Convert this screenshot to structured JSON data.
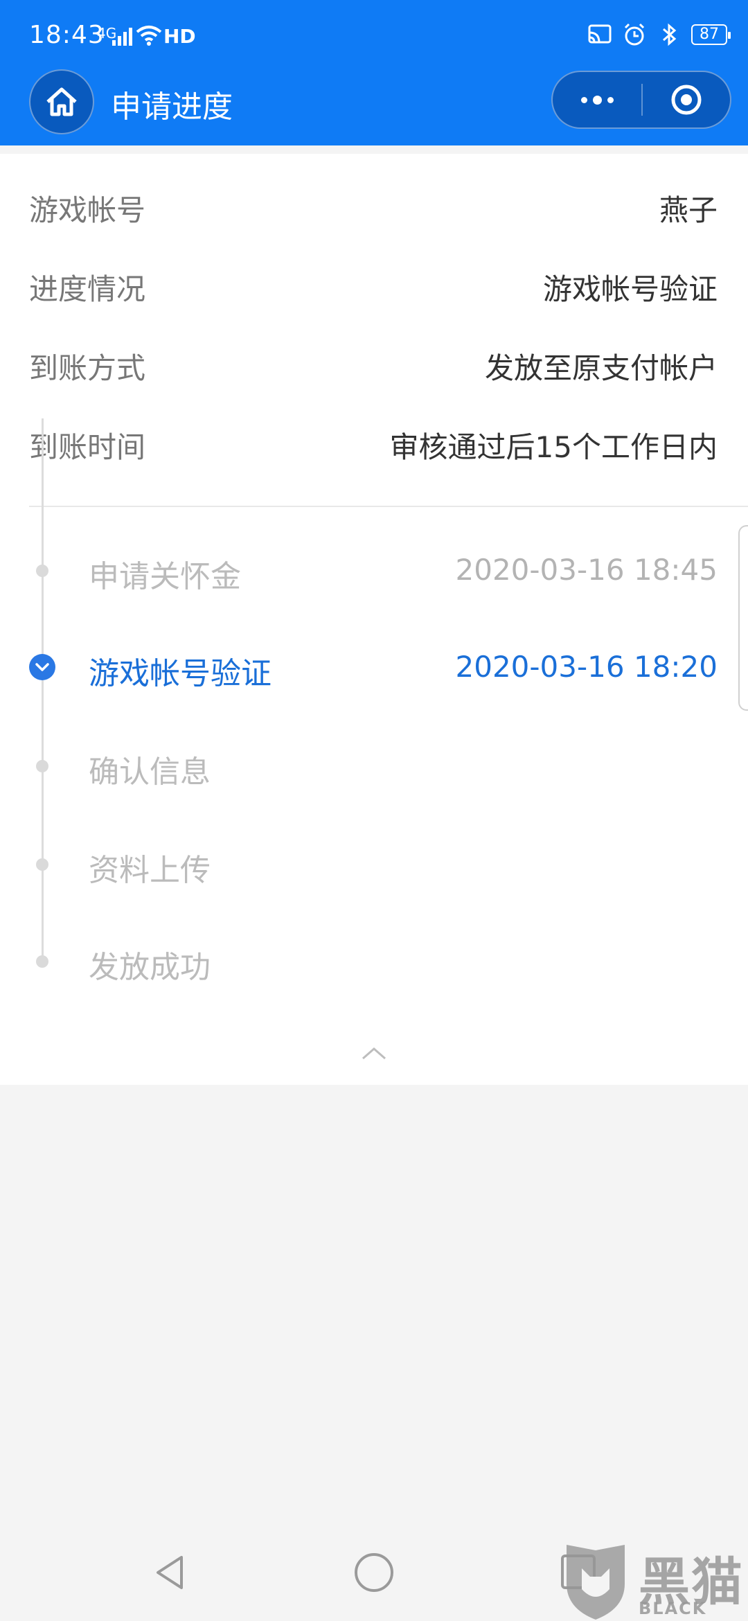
{
  "status_bar": {
    "time": "18:43",
    "network": "4G",
    "hd": "HD",
    "battery": "87"
  },
  "header": {
    "title": "申请进度",
    "accent_color": "#0f7bf5"
  },
  "info": [
    {
      "label": "游戏帐号",
      "value": "燕子"
    },
    {
      "label": "进度情况",
      "value": "游戏帐号验证"
    },
    {
      "label": "到账方式",
      "value": "发放至原支付帐户"
    },
    {
      "label": "到账时间",
      "value": "审核通过后15个工作日内"
    }
  ],
  "timeline": [
    {
      "name": "申请关怀金",
      "time": "2020-03-16 18:45",
      "state": "done"
    },
    {
      "name": "游戏帐号验证",
      "time": "2020-03-16 18:20",
      "state": "current"
    },
    {
      "name": "确认信息",
      "time": "",
      "state": "pending"
    },
    {
      "name": "资料上传",
      "time": "",
      "state": "pending"
    },
    {
      "name": "发放成功",
      "time": "",
      "state": "pending"
    }
  ],
  "watermark": {
    "brand": "黑猫",
    "sub": "BLACK CAT"
  }
}
